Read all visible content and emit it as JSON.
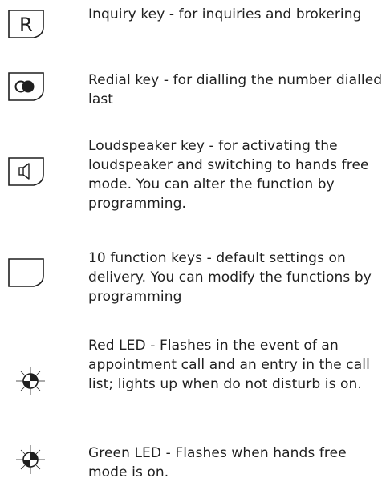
{
  "items": [
    {
      "icon": "r-key-icon",
      "key_label": "R",
      "text": "Inquiry key - for inquiries and brokering"
    },
    {
      "icon": "redial-key-icon",
      "text": "Redial key - for dialling the number dialled last"
    },
    {
      "icon": "loudspeaker-key-icon",
      "text": "Loudspeaker key - for activating the loudspeaker and switching to hands free mode. You can alter the function by programming."
    },
    {
      "icon": "function-key-icon",
      "text": "10 function keys - default settings on delivery. You can modify the functions by programming"
    },
    {
      "icon": "red-led-icon",
      "text": "Red LED - Flashes in the event of an appointment call and an entry in the call list; lights up when do not disturb is on."
    },
    {
      "icon": "green-led-icon",
      "text": "Green LED - Flashes when hands free mode is on."
    }
  ]
}
